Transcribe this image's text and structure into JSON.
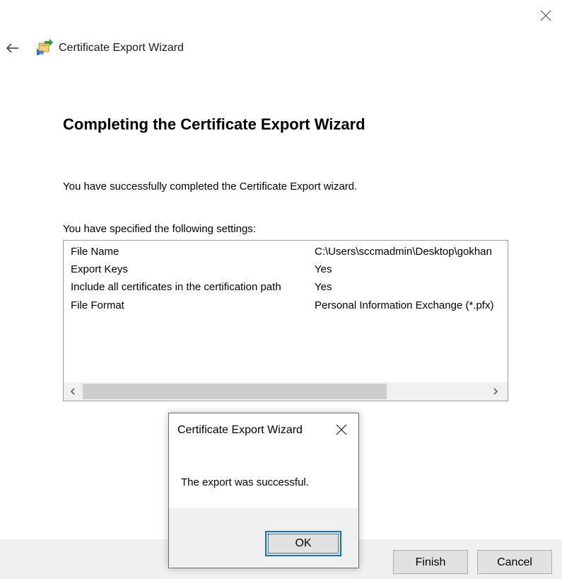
{
  "window": {
    "title": "Certificate Export Wizard",
    "close_icon": "close-icon",
    "back_icon": "back-arrow-icon",
    "app_icon": "certificate-export-icon"
  },
  "main": {
    "heading": "Completing the Certificate Export Wizard",
    "success_message": "You have successfully completed the Certificate Export wizard.",
    "settings_label": "You have specified the following settings:",
    "settings": [
      {
        "key": "File Name",
        "value": "C:\\Users\\sccmadmin\\Desktop\\gokhan"
      },
      {
        "key": "Export Keys",
        "value": "Yes"
      },
      {
        "key": "Include all certificates in the certification path",
        "value": "Yes"
      },
      {
        "key": "File Format",
        "value": "Personal Information Exchange (*.pfx)"
      }
    ]
  },
  "footer": {
    "finish_label": "Finish",
    "cancel_label": "Cancel"
  },
  "msgbox": {
    "title": "Certificate Export Wizard",
    "message": "The export was successful.",
    "ok_label": "OK"
  },
  "colors": {
    "accent": "#0078d7",
    "footer_bg": "#f0f0f0",
    "button_bg": "#e1e1e1"
  }
}
